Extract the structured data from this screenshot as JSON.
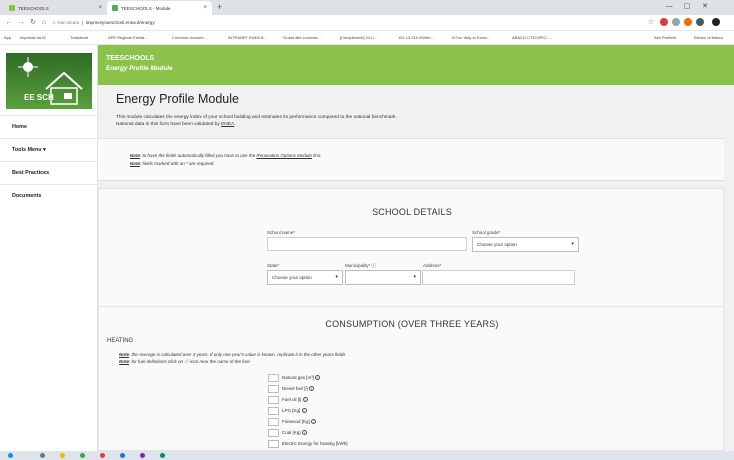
{
  "browser": {
    "tabs": [
      {
        "title": "TEESCHOOLS",
        "active": false
      },
      {
        "title": "TEESCHOOLS - Module",
        "active": true
      }
    ],
    "url_security": "Non sicuro",
    "url": "improveyourschool.enea.it/energy",
    "window_controls": [
      "—",
      "▢",
      "✕"
    ],
    "bookmarks": [
      "App",
      "Importati da IE",
      "Traduttore",
      "APE Regione Emilia...",
      "Common docume...",
      "INTRANET ENEA B...",
      "\"Guida alle conness...",
      "[Complimenti] 24 C...",
      "151.13.210.5/Web...",
      "A Fun Way to Exerc...",
      "ABACO CTICOPIO -...",
      "Altri Preferiti",
      "Elenco di lettura"
    ]
  },
  "app": {
    "brand_title": "TEESCHOOLS",
    "brand_subtitle": "Energy Profile Module",
    "logo_text": "EE SCH",
    "brand_color": "#8bc34a",
    "menu": [
      {
        "label": "Home"
      },
      {
        "label": "Tools Menu ▾"
      },
      {
        "label": "Best Practices"
      },
      {
        "label": "Documents"
      }
    ]
  },
  "page": {
    "title": "Energy Profile Module",
    "intro_line1": "This module calculates the energy index of your school building and estimates its performance compared to the national benchmark.",
    "intro_line2_prefix": "National data in this form have been validated by ",
    "intro_line2_link": "ENEA",
    "intro_line2_suffix": ".",
    "notes": [
      {
        "label": "Note",
        "text_prefix": ": to have the fields automatically filled you have to use the ",
        "link": "Renovation Options Module",
        "text_suffix": " first."
      },
      {
        "label": "Note",
        "text_prefix": ": fields marked with an * are required.",
        "link": "",
        "text_suffix": ""
      }
    ]
  },
  "school_details": {
    "title": "SCHOOL DETAILS",
    "school_name_label": "School name*",
    "school_name_value": "",
    "school_grade_label": "School grade*",
    "school_grade_value": "Choose your option",
    "state_label": "State*",
    "state_value": "Choose your option",
    "municipality_label": "Municipality* ⓘ",
    "municipality_value": "",
    "address_label": "Address*",
    "address_value": ""
  },
  "consumption": {
    "title": "CONSUMPTION (OVER THREE YEARS)",
    "heating_label": "HEATING",
    "notes": [
      {
        "label": "Note",
        "text": ": the Average is calculated over 3 years. If only one year's value is known, replicate it in the other years fields"
      },
      {
        "label": "Note",
        "text": ": for fuel definitions click on ⓘ icon near the name of the fuel"
      }
    ],
    "fuels": [
      {
        "label": "Natural gas [m³]",
        "info": true
      },
      {
        "label": "Diesel fuel [l]",
        "info": true
      },
      {
        "label": "Fuel oil [l]",
        "info": true
      },
      {
        "label": "LPG [Kg]",
        "info": true
      },
      {
        "label": "Firewood [Kg]",
        "info": true
      },
      {
        "label": "Coal [Kg]",
        "info": true
      },
      {
        "label": "Electric Energy for heating [kWh]",
        "info": false
      }
    ]
  }
}
